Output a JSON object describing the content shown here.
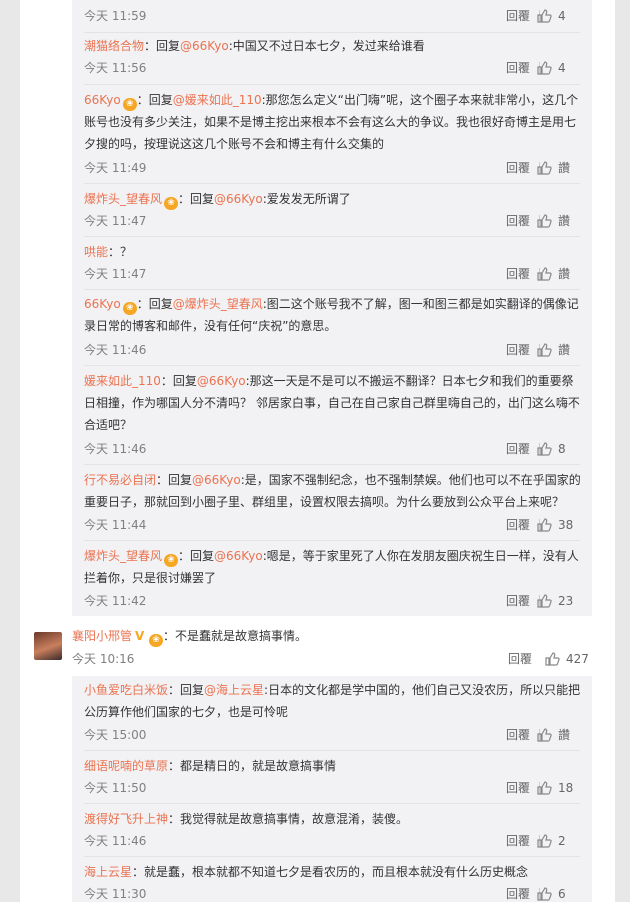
{
  "ui": {
    "reply_label": "回覆",
    "like_word": "讚"
  },
  "replies": [
    {
      "time": "今天 11:59",
      "likes": "4"
    },
    {
      "name": "潮猫络合物",
      "prefix": "：回复",
      "at": "@66Kyo",
      "text": ":中国又不过日本七夕，发过来给谁看",
      "time": "今天 11:56",
      "likes": "4"
    },
    {
      "name": "66Kyo",
      "badge": true,
      "prefix": "：回复",
      "at": "@媛来如此_110",
      "text": ":那您怎么定义“出门嗨”呢，这个圈子本来就非常小，这几个账号也没有多少关注，如果不是博主挖出来根本不会有这么大的争议。我也很好奇博主是用七夕搜的吗，按理说这这几个账号不会和博主有什么交集的",
      "time": "今天 11:49",
      "likes": "讚"
    },
    {
      "name": "爆炸头_望春风",
      "badge": true,
      "prefix": "：回复",
      "at": "@66Kyo",
      "text": ":爱发发无所谓了",
      "time": "今天 11:47",
      "likes": "讚"
    },
    {
      "name": "哄能",
      "prefix": "：",
      "text": "？",
      "time": "今天 11:47",
      "likes": "讚"
    },
    {
      "name": "66Kyo",
      "badge": true,
      "prefix": "：回复",
      "at": "@爆炸头_望春风",
      "text": ":图二这个账号我不了解，图一和图三都是如实翻译的偶像记录日常的博客和邮件，没有任何“庆祝”的意思。",
      "time": "今天 11:46",
      "likes": "讚"
    },
    {
      "name": "媛来如此_110",
      "prefix": "：回复",
      "at": "@66Kyo",
      "text": ":那这一天是不是可以不搬运不翻译？日本七夕和我们的重要祭日相撞，作为哪国人分不清吗？ 邻居家白事，自己在自己家自己群里嗨自己的，出门这么嗨不合适吧？",
      "time": "今天 11:46",
      "likes": "8"
    },
    {
      "name": "行不易必自闭",
      "prefix": "：回复",
      "at": "@66Kyo",
      "text": ":是，国家不强制纪念，也不强制禁娱。他们也可以不在乎国家的重要日子，那就回到小圈子里、群组里，设置权限去搞呗。为什么要放到公众平台上来呢？",
      "time": "今天 11:44",
      "likes": "38"
    },
    {
      "name": "爆炸头_望春风",
      "badge": true,
      "prefix": "：回复",
      "at": "@66Kyo",
      "text": ":嗯是，等于家里死了人你在发朋友圈庆祝生日一样，没有人拦着你，只是很讨嫌罢了",
      "time": "今天 11:42",
      "likes": "23"
    }
  ],
  "main_comment": {
    "name": "襄阳小邢管",
    "text": "：不是蠢就是故意搞事情。",
    "time": "今天 10:16",
    "likes": "427"
  },
  "sub_replies": [
    {
      "name": "小鱼爱吃白米饭",
      "prefix": "：回复",
      "at": "@海上云星",
      "text": ":日本的文化都是学中国的，他们自己又没农历，所以只能把公历算作他们国家的七夕，也是可怜呢",
      "time": "今天 15:00",
      "likes": "讚"
    },
    {
      "name": "细语呢喃的草原",
      "prefix": "：",
      "text": "都是精日的，就是故意搞事情",
      "time": "今天 11:50",
      "likes": "18"
    },
    {
      "name": "渡得好飞升上神",
      "prefix": "：",
      "text": "我觉得就是故意搞事情，故意混淆，装傻。",
      "time": "今天 11:46",
      "likes": "2"
    },
    {
      "name": "海上云星",
      "prefix": "：",
      "text": "就是蠢，根本就都不知道七夕是看农历的，而且根本就没有什么历史概念",
      "time": "今天 11:30",
      "likes": "6"
    }
  ],
  "colors": {
    "accent": "#eb7350",
    "badge": "#f5a623"
  }
}
